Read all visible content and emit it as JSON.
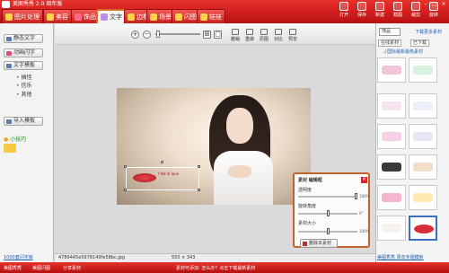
{
  "app": {
    "title": "美图秀秀 2.0 周年版"
  },
  "tabs": [
    {
      "label": "图片处理"
    },
    {
      "label": "美容"
    },
    {
      "label": "饰品"
    },
    {
      "label": "文字"
    },
    {
      "label": "边框"
    },
    {
      "label": "场景"
    },
    {
      "label": "闪图"
    },
    {
      "label": "娃娃"
    }
  ],
  "top_right": [
    "打开",
    "保存",
    "新建",
    "截图",
    "裁剪",
    "旋转"
  ],
  "left_panel": {
    "buttons": [
      "静态文字",
      "动画闪字",
      "文字模板"
    ],
    "items": [
      "搞怪",
      "信乐",
      "其他"
    ],
    "import_label": "导入模板",
    "tip_label": "小技巧",
    "footer_link": "1000套闪字库"
  },
  "canvas_toolbar": {
    "tools": [
      "撤销",
      "重做",
      "原图",
      "对比",
      "预览"
    ]
  },
  "sticker": {
    "text": "I fell in love"
  },
  "props_panel": {
    "title": "素材 编辑框",
    "rows": [
      {
        "label": "透明度",
        "value": "100%",
        "level": 1.0
      },
      {
        "label": "旋转角度",
        "value": "0°",
        "level": 0.5
      },
      {
        "label": "素材大小",
        "value": "100%",
        "level": 0.5
      }
    ],
    "delete_label": "删除本素材"
  },
  "right_panel": {
    "tabs": [
      "饰品",
      "下载更多素材",
      "在线素材",
      "已下载"
    ],
    "link": "Ｊ国际最新最热素材",
    "bottom_link": "美图秀秀 周年专题模板"
  },
  "status": {
    "file": "4789445e5978149fe58bc.jpg",
    "size": "550 × 343",
    "hint": "素材可添加: 怎么办？点击下载最新素材",
    "left_items": [
      "美图秀秀",
      "美图闪图",
      "分享素材"
    ]
  }
}
